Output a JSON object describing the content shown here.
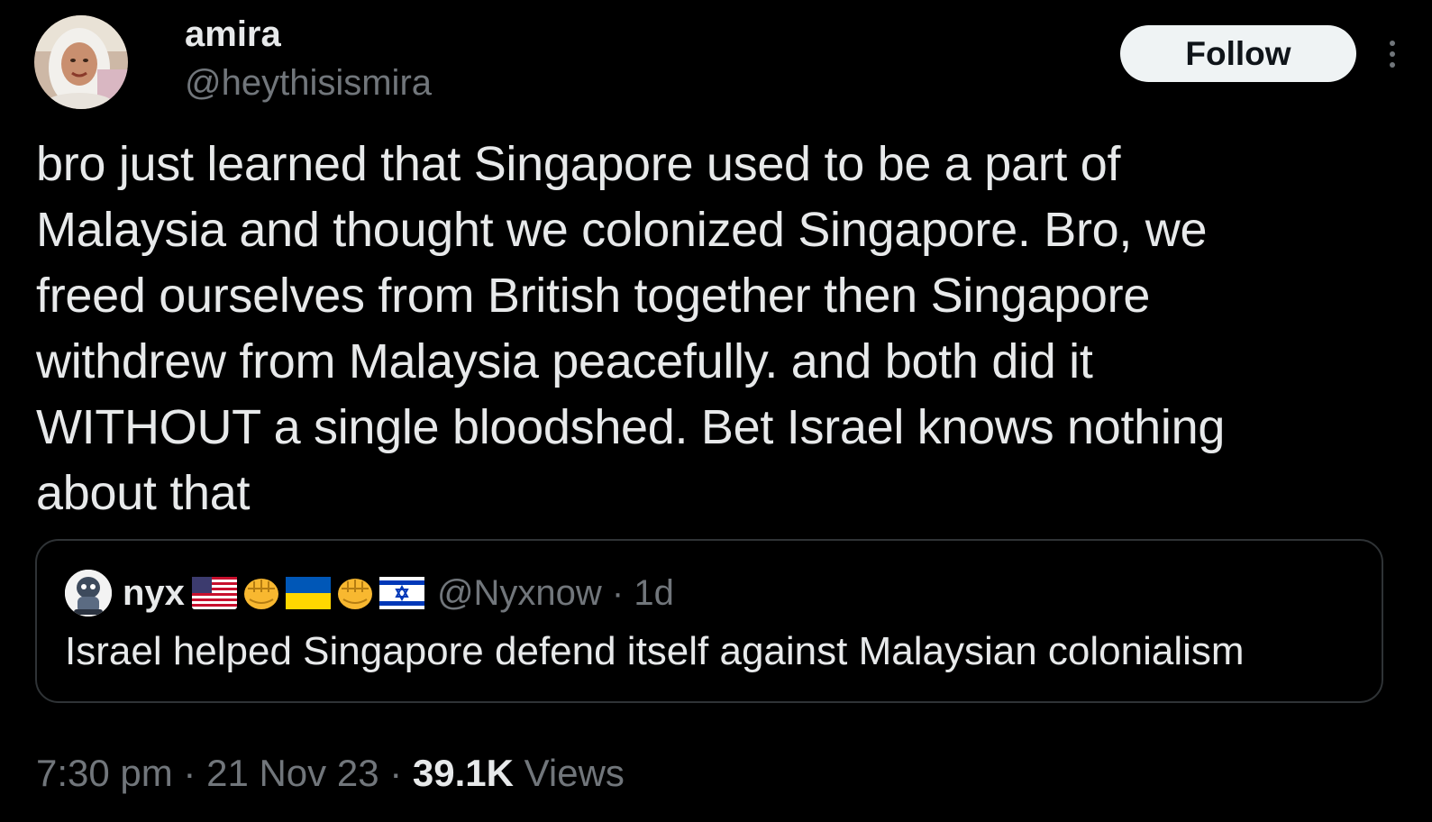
{
  "author": {
    "display_name": "amira",
    "handle": "@heythisismira",
    "avatar_icon": "profile-photo"
  },
  "follow_label": "Follow",
  "more_icon": "more-vertical-icon",
  "text": "bro just learned that Singapore used to be a part of\nMalaysia and thought we colonized Singapore. Bro, we\nfreed ourselves from British together then Singapore\nwithdrew from Malaysia peacefully. and both did it\nWITHOUT a single bloodshed. Bet Israel knows nothing\nabout that",
  "quoted": {
    "name": "nyx",
    "name_emojis": [
      "us-flag",
      "raised-fist",
      "ukraine-flag",
      "raised-fist",
      "israel-flag"
    ],
    "handle_time": "@Nyxnow · 1d",
    "text": "Israel helped Singapore defend itself against Malaysian colonialism"
  },
  "meta": {
    "time": "7:30 pm",
    "separator": " · ",
    "date": "21 Nov 23",
    "views_count": "39.1K",
    "views_label": " Views"
  },
  "colors": {
    "background": "#000000",
    "text": "#e7e9ea",
    "secondary": "#71767b",
    "border": "#2f3336",
    "follow_bg": "#eff3f4"
  }
}
